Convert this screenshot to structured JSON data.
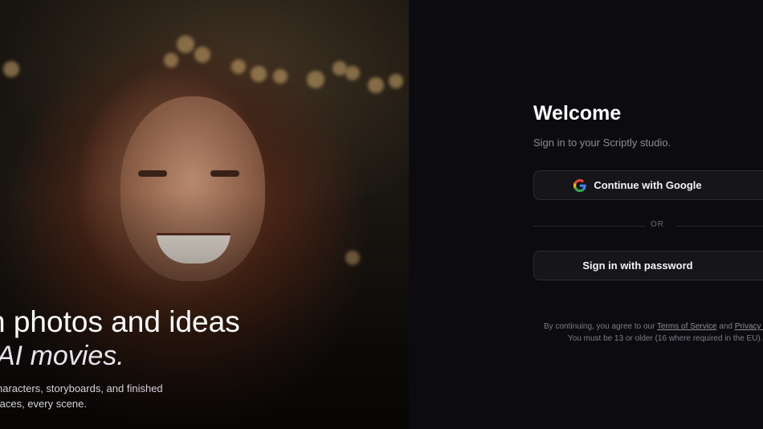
{
  "hero": {
    "headline_line1": "n photos and ideas",
    "headline_line2": "AI movies.",
    "sub_line1": "haracters, storyboards, and finished",
    "sub_line2": "faces, every scene."
  },
  "auth": {
    "title": "Welcome",
    "subtitle": "Sign in to your Scriptly studio.",
    "google_button": "Continue with Google",
    "divider": "OR",
    "password_button": "Sign in with password",
    "legal_prefix": "By continuing, you agree to our ",
    "terms_link": "Terms of Service",
    "legal_and": " and ",
    "privacy_link": "Privacy Po",
    "age_notice": "You must be 13 or older (16 where required in the EU)."
  },
  "colors": {
    "panel_bg": "#0c0c10",
    "button_bg": "#15151a",
    "button_border": "#2c2c34",
    "muted_text": "#8c8a96"
  },
  "icons": {
    "google": "google-g-icon"
  }
}
